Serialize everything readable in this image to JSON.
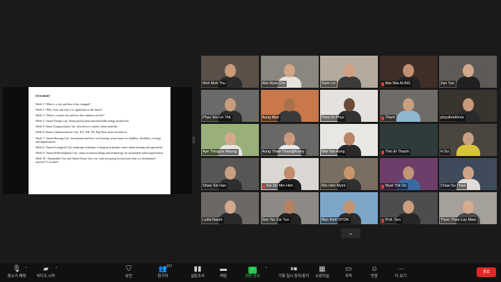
{
  "document": {
    "title": "[Schedule]",
    "lines": [
      "Week 1 / What is a city and how it has changed?",
      "Week 2 / Why cities and why it is significant in the future?",
      "Week 3 / What is a smart city and how this enhance our life?",
      "Week 4 / Smart Energy City: Smart grid system and renewable energy production",
      "Week 5/ Smart Transportation City: driverless to carless, drone mobility",
      "Week 6/ Smart Communications City: ICT, AR, VR, Big Data, smart revolution",
      "Week 7 / Smart Housing City: incremental and low-cost housing, smart home for mobility, flexibility, ecology and digitalization",
      "Week 8 / Smart Ecological City: landscape urbanism, ecological urbanism, smart urban farming and agriculture",
      "Week 9 / Smart Redevelopment City: smart recreation design and technology for sustainable urban regeneration",
      "Week 10 / Sustainable City and Smart Future: how our cities are going forward and what is a destination? survival Vs exodus?"
    ]
  },
  "participants": [
    {
      "name": "Moh Moh Thu",
      "muted": false,
      "bg": "#5a5048",
      "skin": "#c99b7a",
      "shirt": "#2a2a2a"
    },
    {
      "name": "Wai Myat Cho",
      "muted": false,
      "bg": "#8a8680",
      "skin": "#d3a486",
      "shirt": "#e8e3de"
    },
    {
      "name": "Sizin Lin",
      "muted": false,
      "bg": "#b4aa9e",
      "skin": "#cfa081",
      "shirt": "#3a3a3a"
    },
    {
      "name": "Wai Wai AUNG",
      "muted": true,
      "bg": "#3d2f27",
      "skin": "#c28f70",
      "shirt": "#222222"
    },
    {
      "name": "Zan Tun",
      "muted": false,
      "bg": "#5e5a57",
      "skin": "#d0a88c",
      "shirt": "#202020"
    },
    {
      "name": "Phyu Sin Lin Thit",
      "muted": false,
      "bg": "#6c6a68",
      "skin": "#c89d7f",
      "shirt": "#2c2c2c"
    },
    {
      "name": "Aung Moe",
      "muted": false,
      "bg": "#c8784a",
      "skin": "#a77150",
      "shirt": "#3a3a3a"
    },
    {
      "name": "Pann Ei Phyu",
      "muted": false,
      "bg": "#e5e2de",
      "skin": "#6b4a38",
      "shirt": "#333333"
    },
    {
      "name": "Thant",
      "muted": true,
      "bg": "#6f6c68",
      "skin": "#c99f80",
      "shirt": "#8fb7d0"
    },
    {
      "name": "phyuthetkhine",
      "muted": false,
      "bg": "#3a342f",
      "skin": "#c69a7b",
      "shirt": "#2a2a2a"
    },
    {
      "name": "Aye Thingzar Maung",
      "muted": false,
      "bg": "#9ab07a",
      "skin": "#d4a98b",
      "shirt": "#e8e6e2"
    },
    {
      "name": "Aung Thaw Thaw@Kamy",
      "muted": false,
      "bg": "#6a6866",
      "skin": "#c89a79",
      "shirt": "#eaeaea"
    },
    {
      "name": "Wai Yan Aung",
      "muted": false,
      "bg": "#e9e7e4",
      "skin": "#b88466",
      "shirt": "#2a2a2a"
    },
    {
      "name": "Thin Ei Thazin",
      "muted": true,
      "bg": "#2f3b3a",
      "skin": "#2f3b3a",
      "shirt": "#2f3b3a"
    },
    {
      "name": "H Su",
      "muted": false,
      "bg": "#4b4540",
      "skin": "#c99f82",
      "shirt": "#d8c438"
    },
    {
      "name": "Shwe Sin Han",
      "muted": false,
      "bg": "#585654",
      "skin": "#caa082",
      "shirt": "#2e2e2e"
    },
    {
      "name": "Sai Zin Min Htet",
      "muted": true,
      "bg": "#dad7d3",
      "skin": "#c08e6e",
      "shirt": "#1e1e1e"
    },
    {
      "name": "Min Htet Myint",
      "muted": false,
      "bg": "#7a6e60",
      "skin": "#c8956f",
      "shirt": "#303030"
    },
    {
      "name": "Myat Thit Oo",
      "muted": true,
      "bg": "#6e3e6a",
      "skin": "#c49478",
      "shirt": "#3b6aa0"
    },
    {
      "name": "Chaw Su Thwe",
      "muted": false,
      "bg": "#3f4a5a",
      "skin": "#cfa385",
      "shirt": "#e0dcd6"
    },
    {
      "name": "Lydia Naunt",
      "muted": false,
      "bg": "#6b6865",
      "skin": "#d1a98c",
      "shirt": "#2a2a2a"
    },
    {
      "name": "Soe Yar Zar Tun",
      "muted": false,
      "bg": "#8d8a86",
      "skin": "#b88262",
      "shirt": "#232323"
    },
    {
      "name": "Myo Hein DYOK",
      "muted": false,
      "bg": "#7ea6c8",
      "skin": "#c69270",
      "shirt": "#2c2c2c"
    },
    {
      "name": "Prof. Seo",
      "muted": true,
      "bg": "#4d4d4d",
      "skin": "#c99e7e",
      "shirt": "#272727"
    },
    {
      "name": "Thwe Thwe Lay Maw",
      "muted": false,
      "bg": "#a6a09a",
      "skin": "#d3ab8e",
      "shirt": "#4a4a4a"
    }
  ],
  "active_speaker": "Prof. Seo",
  "collapse_icon": "chevron-down",
  "toolbar": {
    "mute": "음소거 해제",
    "video": "비디오 시작",
    "security": "보안",
    "participants": "참가자",
    "participant_count": "277",
    "polls": "설문조사",
    "chat": "채팅",
    "share": "화면 공유",
    "record": "기록 일시 중지/중지",
    "breakout": "소회의실",
    "cc": "자막",
    "reactions": "반응",
    "more": "더 보기",
    "end": "종료"
  },
  "colors": {
    "background": "#1a1a1a",
    "toolbar": "#111111",
    "share_green": "#23c552",
    "end_red": "#e02828",
    "active_border": "#e9d43a",
    "muted_red": "#e0403a"
  }
}
